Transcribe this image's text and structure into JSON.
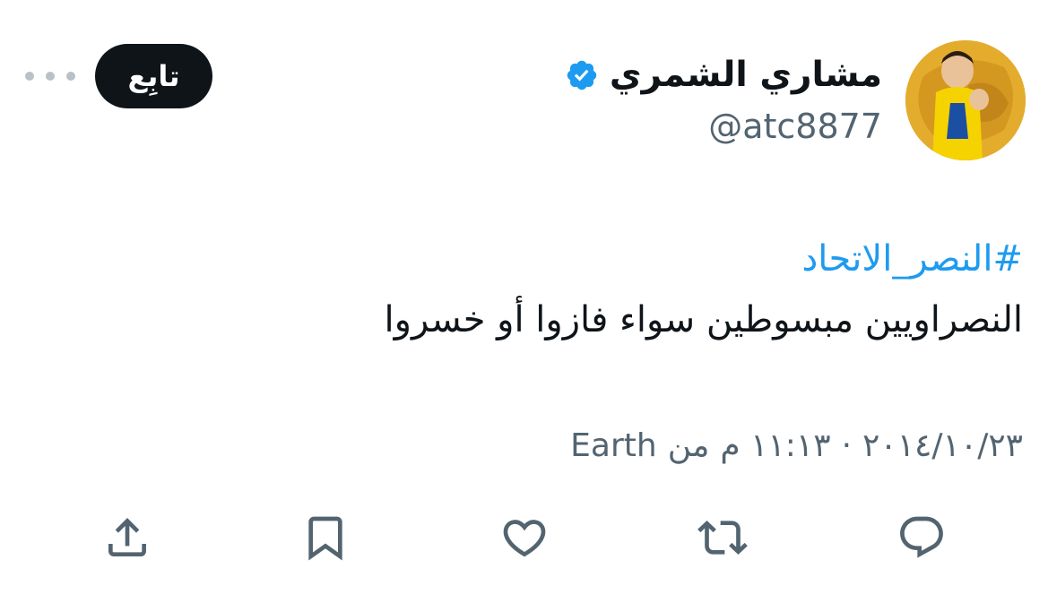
{
  "author": {
    "display_name": "مشاري الشمري",
    "handle": "@atc8877",
    "verified_icon": "verified-badge-icon",
    "avatar_icon": "avatar"
  },
  "actions_header": {
    "follow_label": "تابِع",
    "more_icon": "more-dots-icon"
  },
  "tweet": {
    "hashtag": "#النصر_الاتحاد",
    "text": "النصراويين مبسوطين سواء فازوا أو خسروا",
    "date": "٢٠١٤/١٠/٢٣",
    "separator": "·",
    "time": "١١:١٣ م",
    "source_prefix": "من",
    "source": "Earth"
  },
  "action_bar": [
    {
      "icon": "reply-icon"
    },
    {
      "icon": "retweet-icon"
    },
    {
      "icon": "like-icon"
    },
    {
      "icon": "bookmark-icon"
    },
    {
      "icon": "share-icon"
    }
  ],
  "colors": {
    "accent": "#1d9bf0",
    "text_primary": "#0f1419",
    "text_secondary": "#536471",
    "icon": "#536471",
    "avatar_bg": "#e3ac2c"
  }
}
